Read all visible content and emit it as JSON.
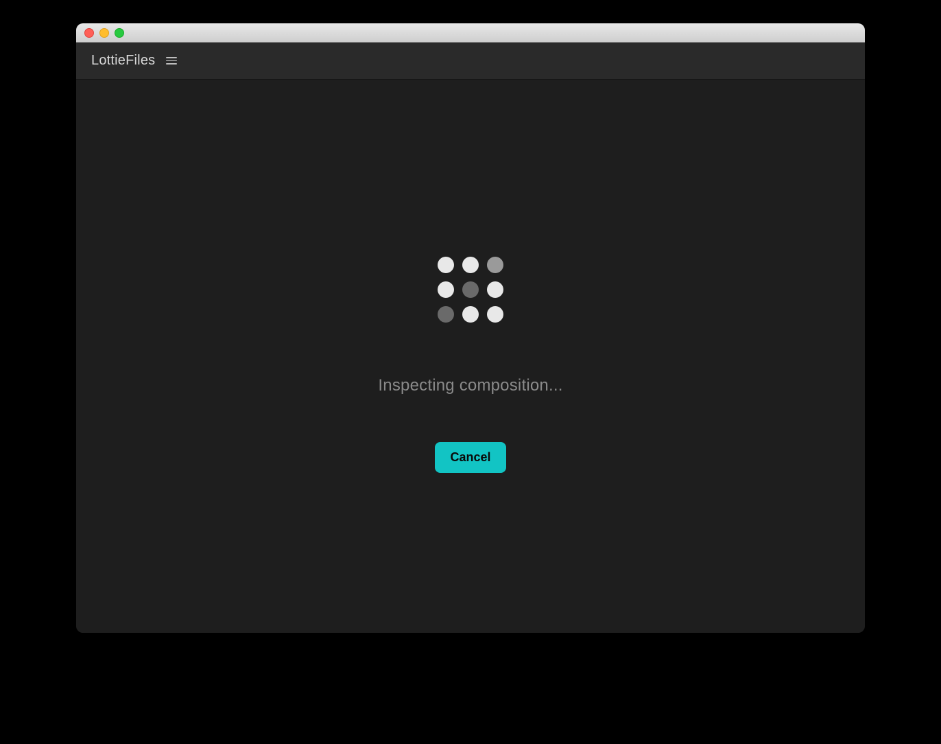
{
  "header": {
    "app_title": "LottieFiles"
  },
  "loading": {
    "status_text": "Inspecting composition...",
    "cancel_label": "Cancel"
  },
  "colors": {
    "accent": "#12c4c4",
    "background": "#1e1e1e",
    "header_bg": "#2a2a2a"
  },
  "icons": {
    "menu": "hamburger-icon",
    "spinner": "dot-grid-spinner"
  }
}
